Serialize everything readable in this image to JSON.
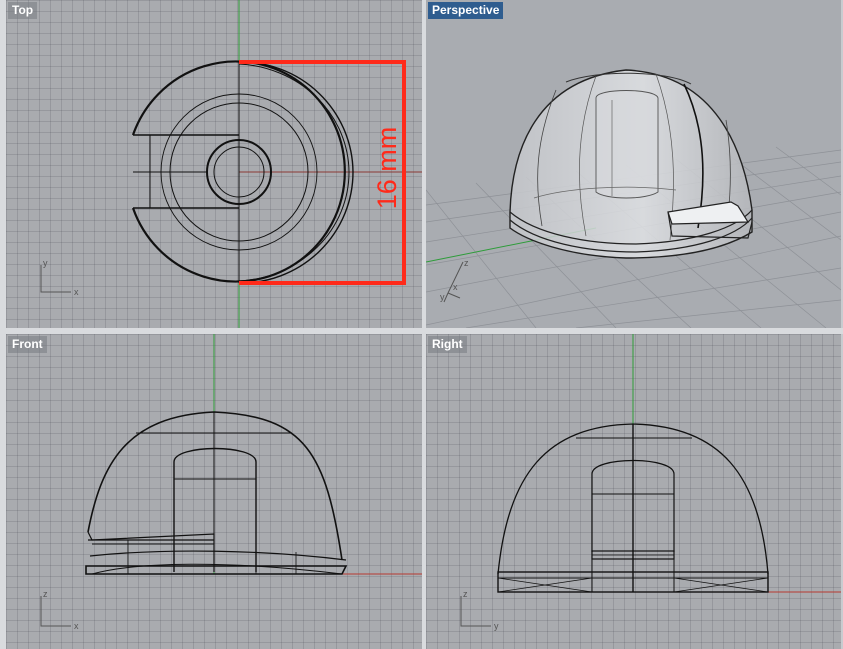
{
  "viewports": {
    "top": {
      "title": "Top"
    },
    "perspective": {
      "title": "Perspective",
      "active": true
    },
    "front": {
      "title": "Front"
    },
    "right": {
      "title": "Right"
    }
  },
  "dimension": {
    "label": "16 mm",
    "color": "#ff2a1a"
  },
  "axis_labels": {
    "top": {
      "v": "y",
      "h": "x"
    },
    "perspective": {
      "z": "z",
      "y": "y",
      "x": "x"
    },
    "front": {
      "v": "z",
      "h": "x"
    },
    "right": {
      "v": "z",
      "h": "y"
    }
  },
  "colors": {
    "x_axis": "#b83a32",
    "y_axis": "#2e9c3a",
    "title_active": "#2f5d8f",
    "viewport_bg": "#a9abaf"
  }
}
